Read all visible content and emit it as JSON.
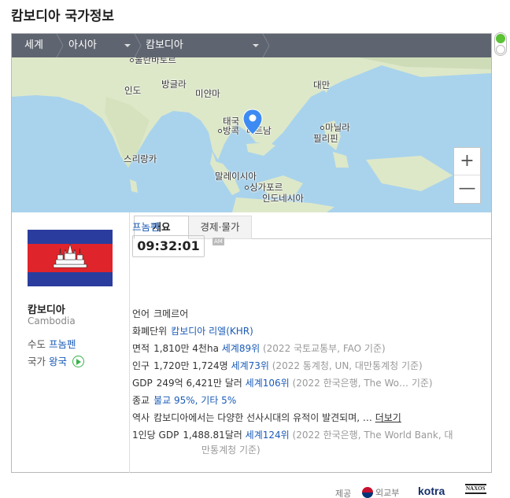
{
  "page": {
    "title": "캄보디아 국가정보"
  },
  "breadcrumb": {
    "world": "세계",
    "region": "아시아",
    "country": "캄보디아"
  },
  "map": {
    "labels": {
      "ulanbator": "울란바토르",
      "india": "인도",
      "bangladesh": "방글라",
      "myanmar": "미얀마",
      "taiwan": "대만",
      "thailand": "태국",
      "bangkok": "방콕",
      "vietnam": "베트남",
      "manila": "마닐라",
      "philippines": "필리핀",
      "srilanka": "스리랑카",
      "malaysia": "말레이시아",
      "singapore": "싱가포르",
      "indonesia": "인도네시아"
    },
    "zoom_in_icon": "plus-icon",
    "zoom_out_icon": "minus-icon"
  },
  "country": {
    "name": "캄보디아",
    "name_en": "Cambodia",
    "capital_label": "수도",
    "capital": "프놈펜",
    "nation_label": "국가",
    "nation": "왕국"
  },
  "tabs": {
    "overview": "개요",
    "economy": "경제·물가"
  },
  "clock": {
    "city": "프놈펜",
    "time": "09:32:01",
    "ampm": "AM"
  },
  "info": {
    "language": {
      "label": "언어",
      "value": "크메르어"
    },
    "currency": {
      "label": "화폐단위",
      "value": "캄보디아 리엘(KHR)"
    },
    "area": {
      "label": "면적",
      "value": "1,810만 4천ha",
      "rank": "세계89위",
      "source": "(2022 국토교통부, FAO 기준)"
    },
    "population": {
      "label": "인구",
      "value": "1,720만 1,724명",
      "rank": "세계73위",
      "source": "(2022 통계청, UN, 대만통계청 기준)"
    },
    "gdp": {
      "label": "GDP",
      "value": "249억 6,421만 달러",
      "rank": "세계106위",
      "source": "(2022 한국은행, The Wo…",
      "source_end": "기준)"
    },
    "religion": {
      "label": "종교",
      "value": "불교 95%, 기타 5%"
    },
    "history": {
      "label": "역사",
      "value": "캄보디아에서는 다양한 선사시대의 유적이 발견되며, …",
      "more": "더보기"
    },
    "gdp_per_capita": {
      "label": "1인당 GDP",
      "value": "1,488.81달러",
      "rank": "세계124위",
      "source": "(2022 한국은행, The World Bank, 대",
      "source_line2": "만통계청 기준)"
    }
  },
  "footer": {
    "provided_by": "제공",
    "mofa": "외교부",
    "kotra": "kotra",
    "naxos": "NAXOS"
  },
  "colors": {
    "breadcrumb_bg": "#5f6570",
    "link": "#1a5bb8",
    "sea": "#a9d3ec",
    "land": "#dfe9cf",
    "pin": "#3d8bf2"
  }
}
